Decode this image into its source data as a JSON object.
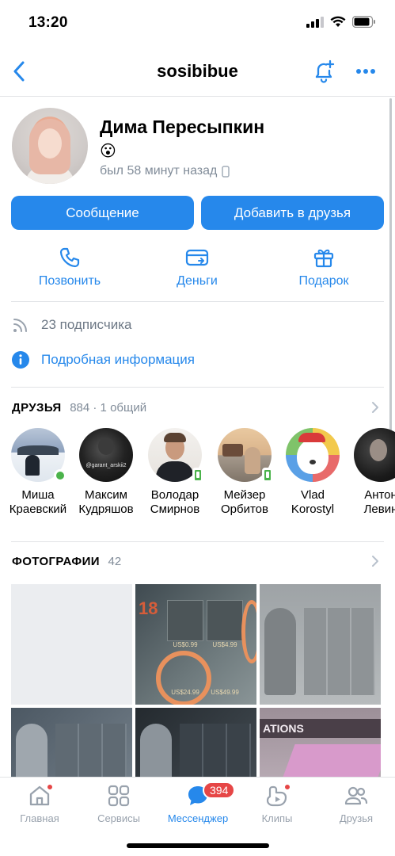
{
  "status_bar": {
    "time": "13:20"
  },
  "nav": {
    "title": "sosibibue"
  },
  "profile": {
    "name": "Дима Пересыпкин",
    "emoji": "😮",
    "last_seen": "был 58 минут назад"
  },
  "buttons": {
    "message": "Сообщение",
    "add_friend": "Добавить в друзья"
  },
  "actions": {
    "call": "Позвонить",
    "money": "Деньги",
    "gift": "Подарок"
  },
  "info": {
    "followers": "23 подписчика",
    "details": "Подробная информация"
  },
  "friends_section": {
    "title": "ДРУЗЬЯ",
    "meta": "884 · 1 общий",
    "items": [
      {
        "first": "Миша",
        "last": "Краевский",
        "status": "online"
      },
      {
        "first": "Максим",
        "last": "Кудряшов",
        "avatar_text": "@garant_arskii2",
        "status": "none"
      },
      {
        "first": "Володар",
        "last": "Смирнов",
        "status": "mobile"
      },
      {
        "first": "Мейзер",
        "last": "Орбитов",
        "status": "mobile"
      },
      {
        "first": "Vlad",
        "last": "Korostyl",
        "status": "none"
      },
      {
        "first": "Антон",
        "last": "Левин",
        "status": "none"
      }
    ]
  },
  "photos_section": {
    "title": "ФОТОГРАФИИ",
    "count": "42",
    "tile_texts": {
      "p2_price1": "US$0.99",
      "p2_price2": "US$4.99",
      "p2_price3": "US$24.99",
      "p2_price4": "US$49.99",
      "p2_big_number": "18",
      "p6_banner": "ATIONS"
    }
  },
  "tab_bar": {
    "tabs": [
      "Главная",
      "Сервисы",
      "Мессенджер",
      "Клипы",
      "Друзья"
    ],
    "messenger_badge": "394",
    "active_index": 2
  },
  "colors": {
    "accent": "#2688eb",
    "online": "#4bb34b",
    "badge": "#e64646",
    "secondary": "#818c99"
  }
}
